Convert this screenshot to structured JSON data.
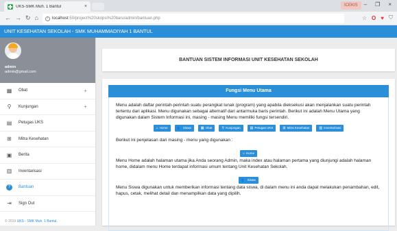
{
  "browser": {
    "tab_title": "UKS-SMK Muh. 1 Bantul",
    "tab_close": "×",
    "window_label": "ICEKIS",
    "win_min": "–",
    "win_max": "❐",
    "win_close": "×",
    "url_host": "localhost",
    "url_path": ":50/project%20skripsi%20baru/admin/bantuan.php"
  },
  "header": {
    "title": "UNIT KESEHATAN SEKOLAH - SMK MUHAMMADIYAH 1 BANTUL"
  },
  "profile": {
    "name": "admin",
    "email": "admin@gmail.com"
  },
  "sidebar": {
    "items": [
      {
        "label": "Obat",
        "icon": "grid-icon",
        "expandable": "+"
      },
      {
        "label": "Kunjungan",
        "icon": "pin-icon",
        "expandable": "+"
      },
      {
        "label": "Petugas UKS",
        "icon": "id-card-icon"
      },
      {
        "label": "Mitra Kesehatan",
        "icon": "plus-square-icon"
      },
      {
        "label": "Berita",
        "icon": "newspaper-icon"
      },
      {
        "label": "Inventarisasi",
        "icon": "archive-icon"
      },
      {
        "label": "Bantuan",
        "icon": "help-icon",
        "active": true
      },
      {
        "label": "Sign Out",
        "icon": "sign-out-icon"
      }
    ],
    "footer_prefix": "© 2019",
    "footer_brand": "UKS - SMK Muh. 1 Bantul."
  },
  "content": {
    "title": "BANTUAN SISTEM INFORMASI UNIT KESEHATAN SEKOLAH",
    "panel_title": "Fungsi Menu Utama",
    "intro": "Menu adalah daftar perintah-perintah suatu perangkat lunak (program) yang apabila dieksekusi akan menjalankan suatu perintah tertentu dari aplikasi. Menu digunakan sebagai alternatif dari antarmuka baris perintah. Berikut ini adalah Menu Utama yang digunakan dalam Sistem Informasi ini, masing - masing Menu memiliki fungsi tersendiri.",
    "buttons": [
      "Home",
      "Siswa",
      "Obat",
      "Kunjungan",
      "Petugas UKS",
      "Mitra Kesehatan",
      "Inventarisasi"
    ],
    "explain_intro": "Berikut ini penjelasan dari masing - menu yang digunakan :",
    "home_label": "Home",
    "home_text": "Menu Home adalah halaman utama jika Anda seorang Admin, maka index atau halaman pertama yang diunjungi adalah halaman home, didalam menu Home terdapat informasi umum tentang Unit Kesehatan Sekolah.",
    "siswa_label": "Siswa",
    "siswa_text": "Menu Siswa digunakan untuk memberikan informasi tentang data siswa, di dalam menu ini anda dapat melakukan penambahan, edit, hapus, cetak, melihat detail dan menampilkan data yang dipilih."
  },
  "colors": {
    "primary": "#2a8fd8",
    "profile_bg": "#8a8f98"
  }
}
